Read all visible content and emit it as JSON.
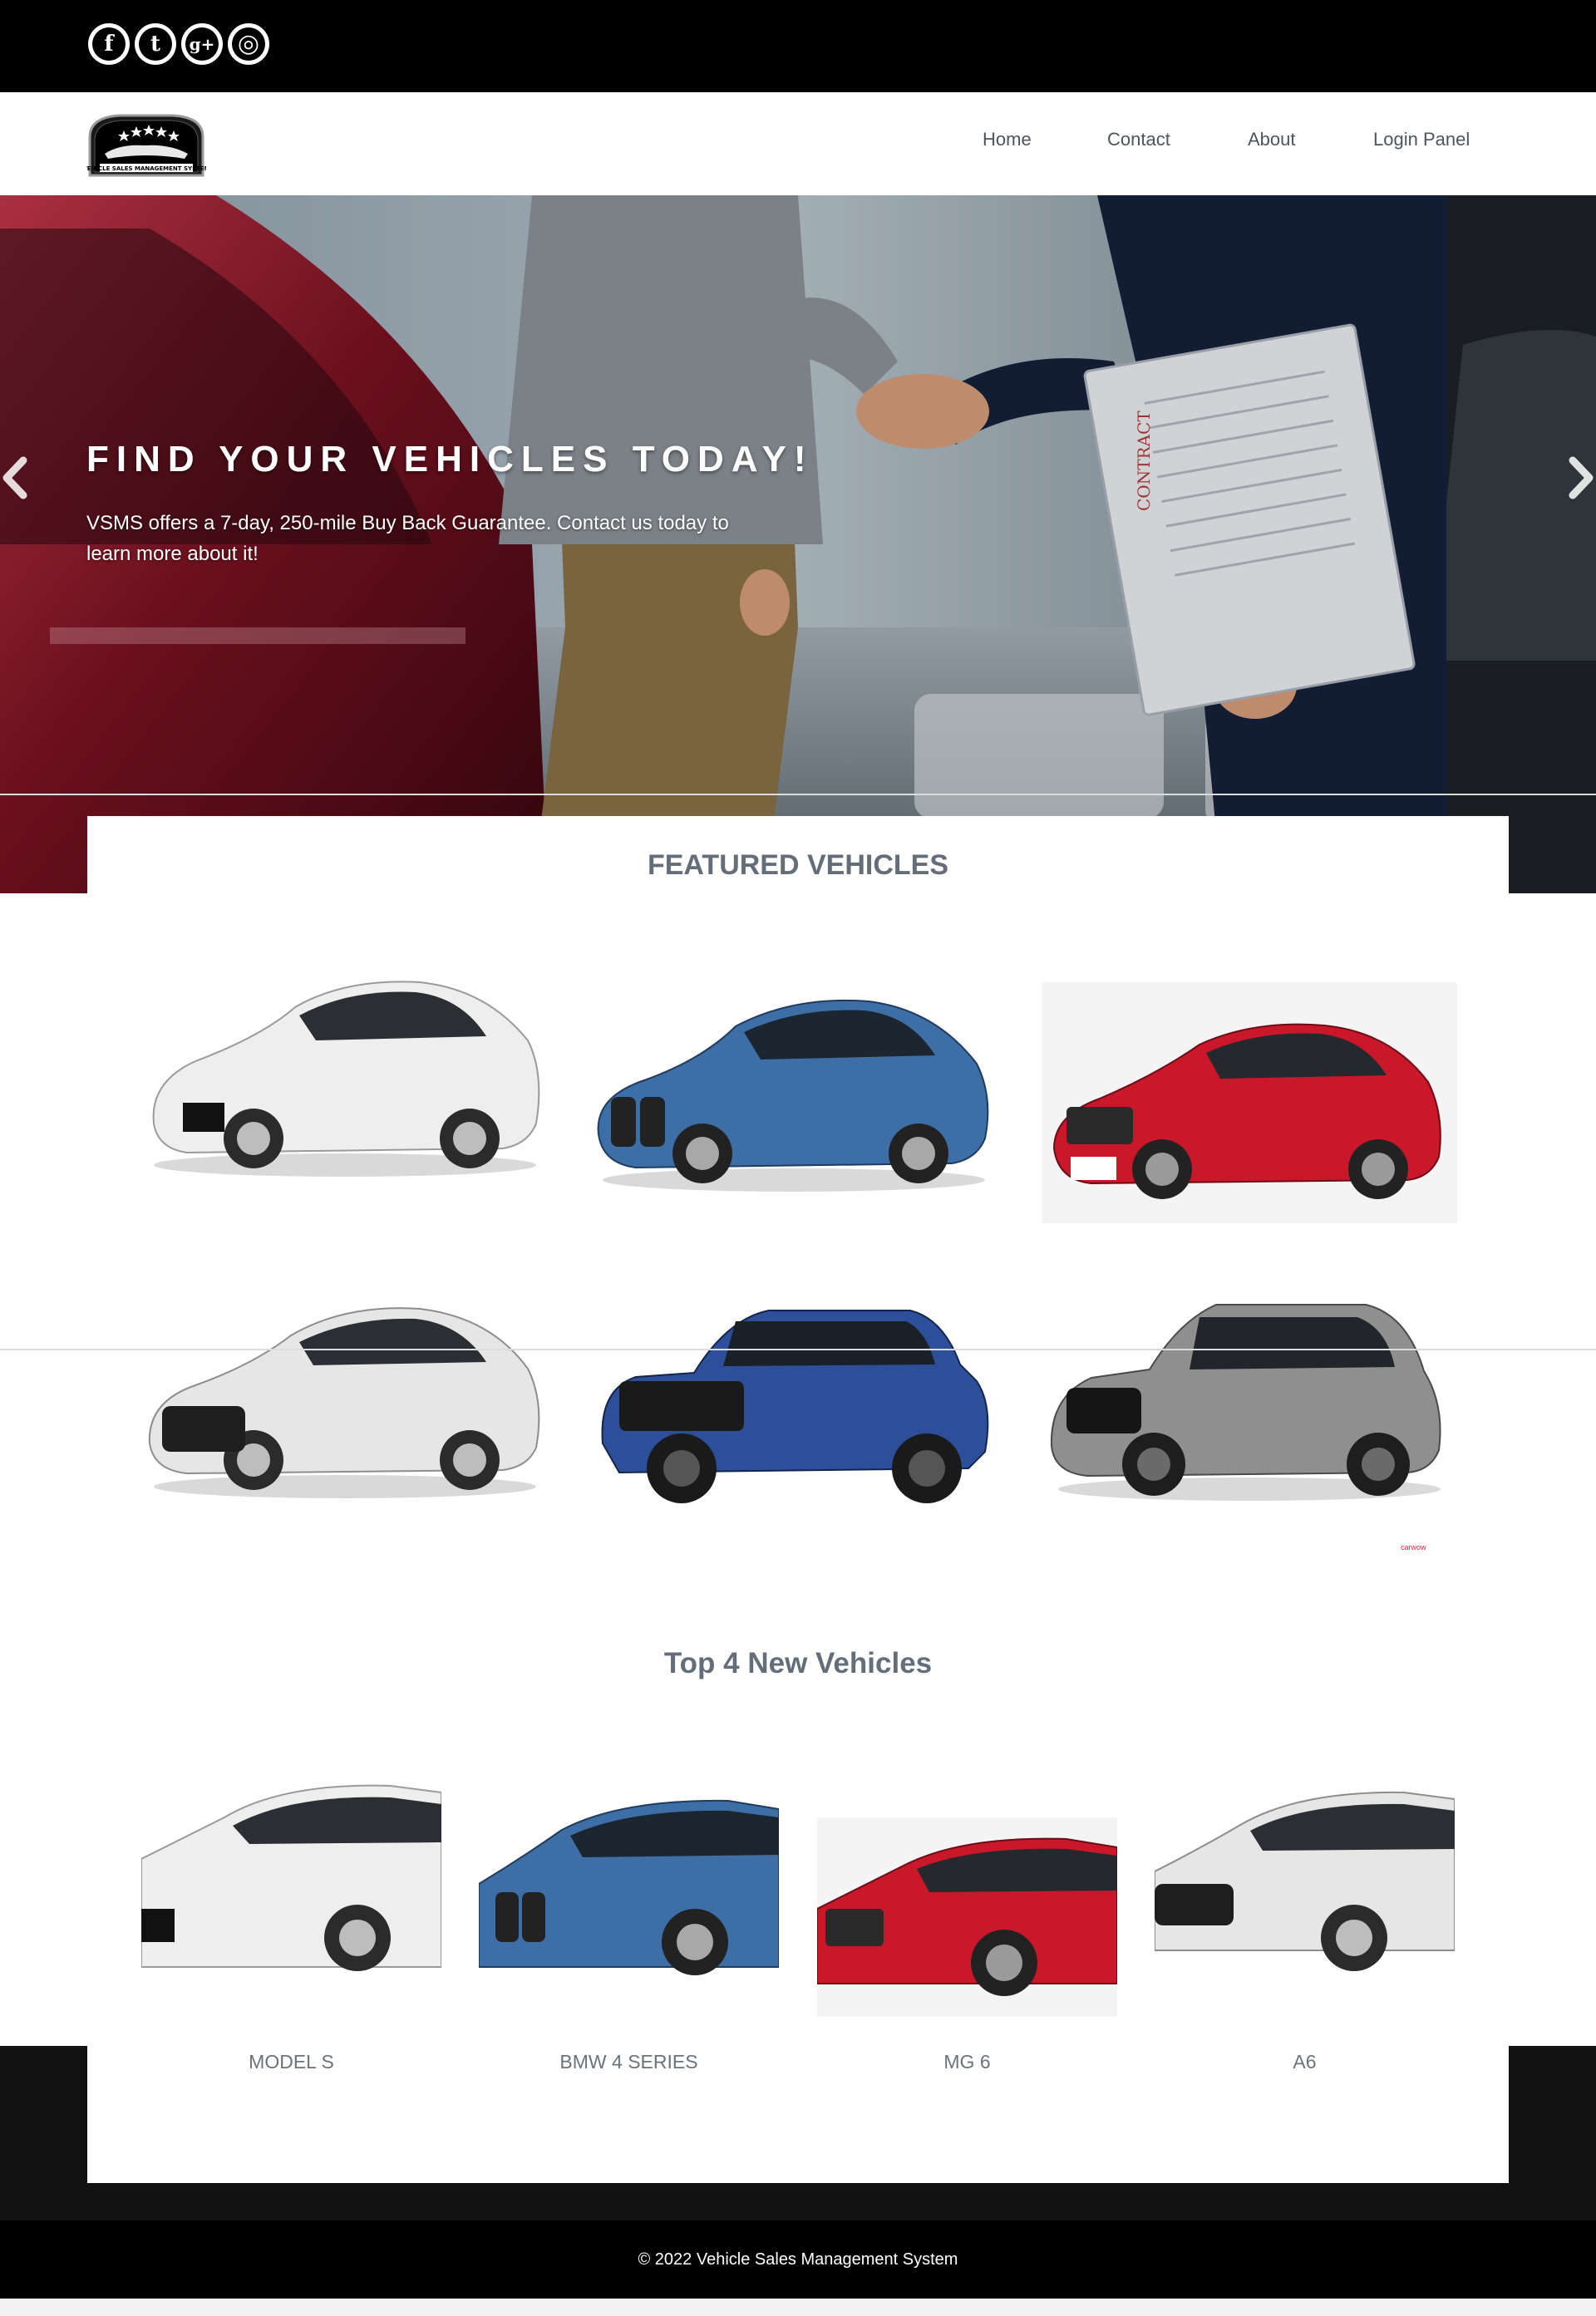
{
  "social": {
    "icons": [
      "facebook-icon",
      "twitter-icon",
      "google-plus-icon",
      "instagram-icon"
    ],
    "glyphs": [
      "f",
      "t",
      "g+",
      "◎"
    ]
  },
  "logo": {
    "text": "VEHICLE SALES MANAGEMENT SYSTEM"
  },
  "nav": {
    "home": "Home",
    "contact": "Contact",
    "about": "About",
    "login": "Login Panel"
  },
  "hero": {
    "title": "FIND YOUR VEHICLES TODAY!",
    "text": "VSMS offers a 7-day, 250-mile Buy Back Guarantee. Contact us today to learn more about it!",
    "contract_label": "CONTRACT"
  },
  "featured": {
    "title": "FEATURED VEHICLES",
    "cars": [
      {
        "name": "white-sedan",
        "color": "#eeeeee"
      },
      {
        "name": "blue-coupe",
        "color": "#3e6ea6"
      },
      {
        "name": "red-sedan",
        "color": "#c8182a"
      },
      {
        "name": "white-audi",
        "color": "#e6e6e6"
      },
      {
        "name": "blue-pickup",
        "color": "#2d4f9a"
      },
      {
        "name": "grey-suv",
        "color": "#8f8f8f"
      }
    ],
    "watermark": "carwow"
  },
  "top4": {
    "title": "Top 4 New Vehicles",
    "cars": [
      {
        "label": "MODEL S",
        "color": "#eeeeee"
      },
      {
        "label": "BMW 4 SERIES",
        "color": "#3e6ea6"
      },
      {
        "label": "MG 6",
        "color": "#c8182a"
      },
      {
        "label": "A6",
        "color": "#e6e6e6"
      }
    ]
  },
  "footer": {
    "copyright": "© 2022 Vehicle Sales Management System"
  },
  "colors": {
    "dark": "#000000",
    "panel_band": "#111111",
    "title": "#646e79",
    "nav_text": "#4d5560"
  }
}
